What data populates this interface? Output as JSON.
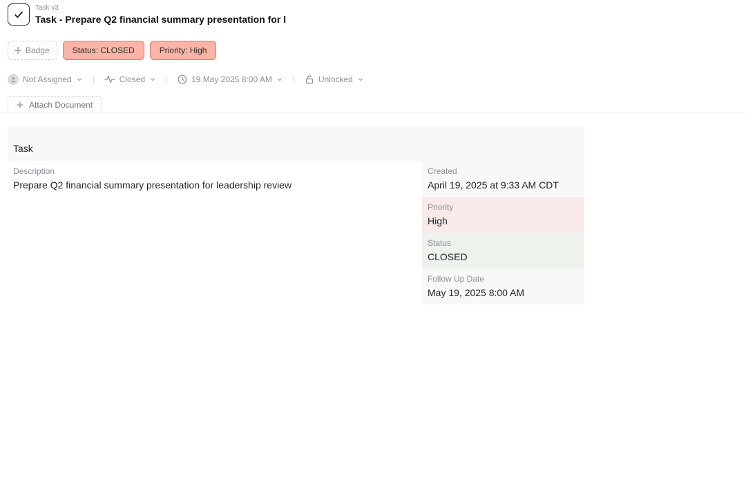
{
  "header": {
    "subtitle": "Task v3",
    "title": "Task - Prepare Q2 financial summary presentation for l"
  },
  "badges": {
    "add_label": "Badge",
    "items": [
      {
        "label": "Status: CLOSED"
      },
      {
        "label": "Priority: High"
      }
    ]
  },
  "meta": {
    "assignee": "Not Assigned",
    "status": "Closed",
    "date": "19 May 2025 8:00 AM",
    "lock": "Unlocked"
  },
  "attach": {
    "label": "Attach Document"
  },
  "card": {
    "heading": "Task",
    "description": {
      "label": "Description",
      "value": "Prepare Q2 financial summary presentation for leadership review"
    },
    "fields": [
      {
        "label": "Created",
        "value": "April 19, 2025 at 9:33 AM CDT"
      },
      {
        "label": "Priority",
        "value": "High"
      },
      {
        "label": "Status",
        "value": "CLOSED"
      },
      {
        "label": "Follow Up Date",
        "value": "May 19, 2025 8:00 AM"
      }
    ]
  },
  "colors": {
    "badge_fill": "#fbb5a8",
    "badge_border": "#e2776a",
    "priority_bg": "#f9eae9",
    "status_bg": "#edf2ec"
  }
}
